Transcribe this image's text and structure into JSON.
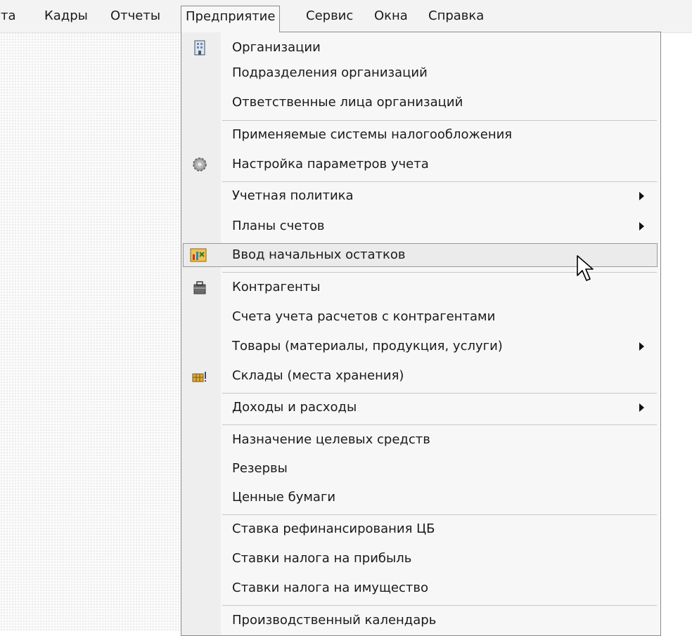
{
  "menubar": {
    "items": [
      {
        "label": "та"
      },
      {
        "label": "Кадры"
      },
      {
        "label": "Отчеты"
      },
      {
        "label": "Предприятие",
        "open": true
      },
      {
        "label": "Сервис"
      },
      {
        "label": "Окна"
      },
      {
        "label": "Справка"
      }
    ]
  },
  "menu": {
    "items": [
      {
        "label": "Организации",
        "icon": "organizations-icon"
      },
      {
        "label": "Подразделения организаций"
      },
      {
        "label": "Ответственные лица организаций"
      },
      {
        "label": "Применяемые системы налогообложения"
      },
      {
        "label": "Настройка параметров учета",
        "icon": "gear-icon"
      },
      {
        "label": "Учетная политика",
        "submenu": true
      },
      {
        "label": "Планы счетов",
        "submenu": true
      },
      {
        "label": "Ввод начальных остатков",
        "icon": "initial-balances-icon",
        "highlighted": true
      },
      {
        "label": "Контрагенты",
        "icon": "counterparties-icon"
      },
      {
        "label": "Счета учета расчетов с контрагентами"
      },
      {
        "label": "Товары (материалы, продукция, услуги)",
        "submenu": true
      },
      {
        "label": "Склады (места хранения)",
        "icon": "warehouse-icon"
      },
      {
        "label": "Доходы и расходы",
        "submenu": true
      },
      {
        "label": "Назначение целевых средств"
      },
      {
        "label": "Резервы"
      },
      {
        "label": "Ценные бумаги"
      },
      {
        "label": "Ставка рефинансирования ЦБ"
      },
      {
        "label": "Ставки налога на прибыль"
      },
      {
        "label": "Ставки налога на имущество"
      },
      {
        "label": "Производственный календарь"
      }
    ]
  }
}
